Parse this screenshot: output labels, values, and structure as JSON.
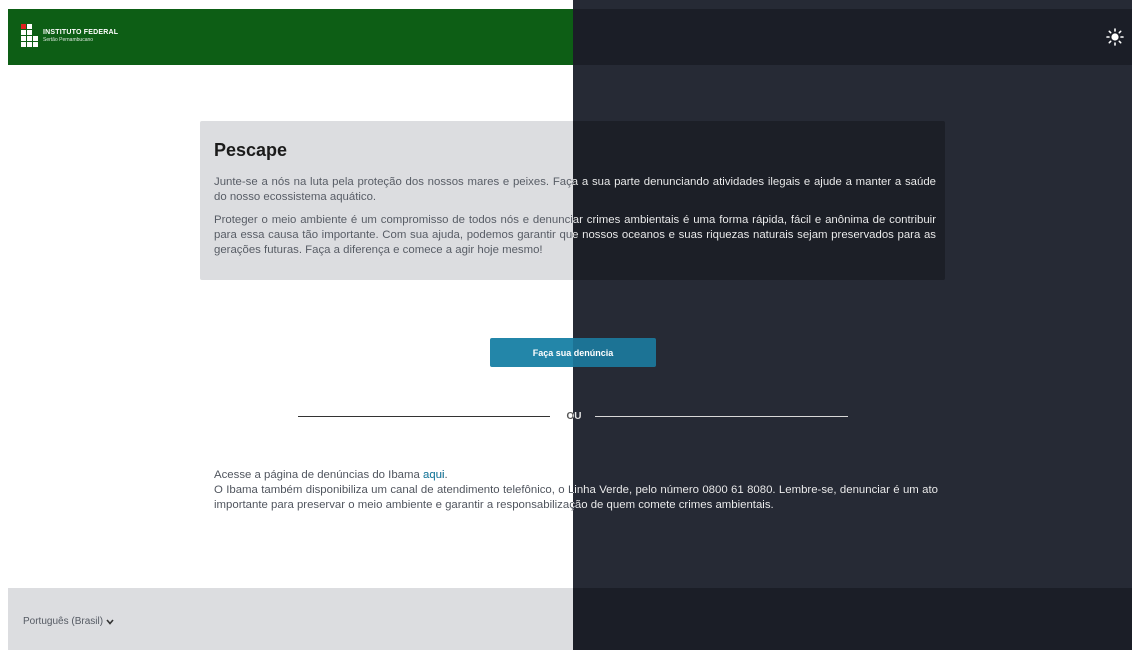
{
  "header": {
    "logo": {
      "line1": "INSTITUTO FEDERAL",
      "line2": "Sertão Pernambucano"
    },
    "theme_toggle_icon": "sun-icon"
  },
  "card": {
    "title": "Pescape",
    "p1": "Junte-se a nós na luta pela proteção dos nossos mares e peixes. Faça a sua parte denunciando atividades ilegais e ajude a manter a saúde do nosso ecossistema aquático.",
    "p2": "Proteger o meio ambiente é um compromisso de todos nós e denunciar crimes ambientais é uma forma rápida, fácil e anônima de contribuir para essa causa tão importante. Com sua ajuda, podemos garantir que nossos oceanos e suas riquezas naturais sejam preservados para as gerações futuras. Faça a diferença e comece a agir hoje mesmo!"
  },
  "cta": {
    "label": "Faça sua denúncia"
  },
  "divider": {
    "label": "OU"
  },
  "info": {
    "line1_prefix": "Acesse a página de denúncias do Ibama ",
    "line1_link": "aqui",
    "line1_suffix": ".",
    "p2": "O Ibama também disponibiliza um canal de atendimento telefônico, o Linha Verde, pelo número 0800 61 8080. Lembre-se, denunciar é um ato importante para preservar o meio ambiente e garantir a responsabilização de quem comete crimes ambientais."
  },
  "footer": {
    "language": "Português (Brasil)",
    "chevron_icon": "chevron-down-icon"
  },
  "colors": {
    "header_green": "#0d5e15",
    "dark_bg": "#262a35",
    "accent": "#2386a9"
  }
}
